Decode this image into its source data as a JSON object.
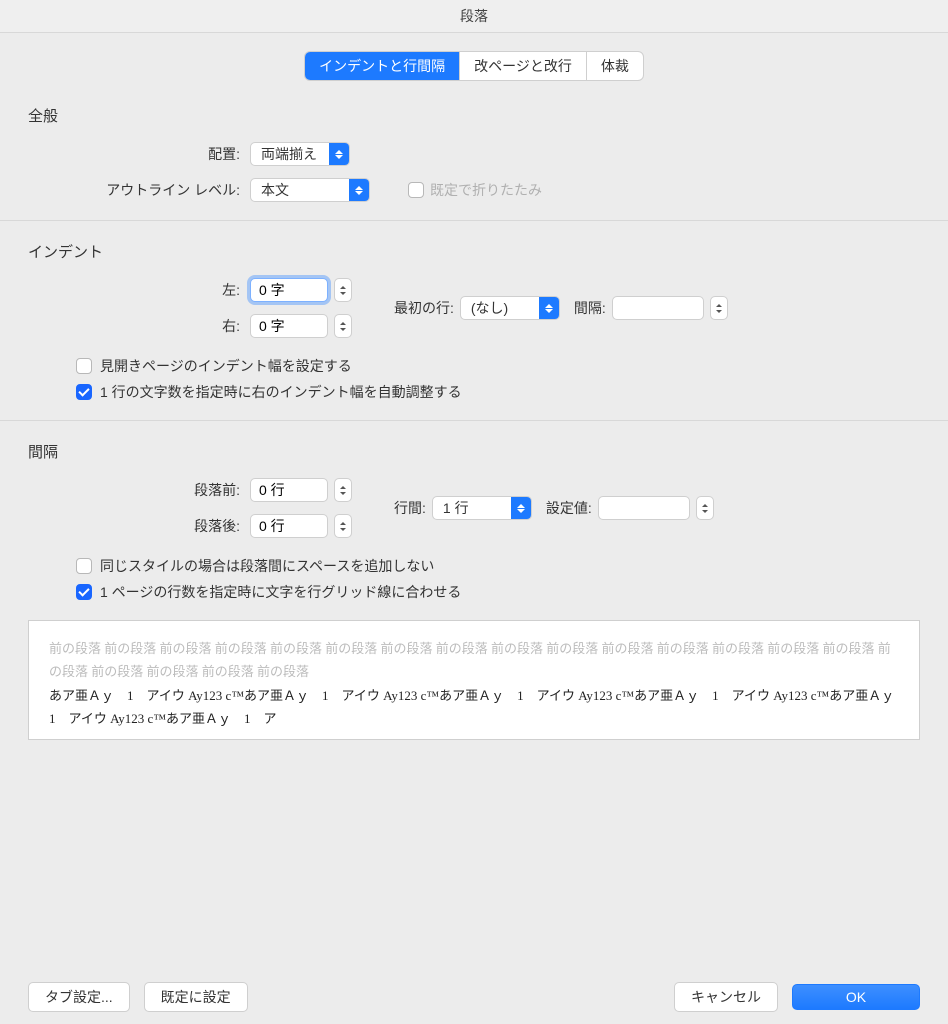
{
  "title": "段落",
  "tabs": {
    "indent": "インデントと行間隔",
    "page": "改ページと改行",
    "style": "体裁"
  },
  "general": {
    "heading": "全般",
    "alignment_label": "配置:",
    "alignment_value": "両端揃え",
    "outline_label": "アウトライン レベル:",
    "outline_value": "本文",
    "collapse_label": "既定で折りたたみ"
  },
  "indent": {
    "heading": "インデント",
    "left_label": "左:",
    "left_value": "0 字",
    "right_label": "右:",
    "right_value": "0 字",
    "firstline_label": "最初の行:",
    "firstline_value": "(なし)",
    "firstline_amount_label": "間隔:",
    "firstline_amount_value": "",
    "mirror_label": "見開きページのインデント幅を設定する",
    "auto_label": "1 行の文字数を指定時に右のインデント幅を自動調整する"
  },
  "spacing": {
    "heading": "間隔",
    "before_label": "段落前:",
    "before_value": "0 行",
    "after_label": "段落後:",
    "after_value": "0 行",
    "line_label": "行間:",
    "line_value": "1 行",
    "at_label": "設定値:",
    "at_value": "",
    "nospace_label": "同じスタイルの場合は段落間にスペースを追加しない",
    "snap_label": "1 ページの行数を指定時に文字を行グリッド線に合わせる"
  },
  "preview": {
    "prev_para": "前の段落 前の段落 前の段落 前の段落 前の段落 前の段落 前の段落 前の段落 前の段落 前の段落 前の段落 前の段落 前の段落 前の段落 前の段落 前の段落 前の段落 前の段落 前の段落 前の段落",
    "sample": "あア亜Ａｙ　1　アイウ Ay123 c™あア亜Ａｙ　1　アイウ Ay123 c™あア亜Ａｙ　1　アイウ Ay123 c™あア亜Ａｙ　1　アイウ Ay123 c™あア亜Ａｙ　1　アイウ Ay123 c™あア亜Ａｙ　1　ア"
  },
  "footer": {
    "tabs": "タブ設定...",
    "default": "既定に設定",
    "cancel": "キャンセル",
    "ok": "OK"
  }
}
